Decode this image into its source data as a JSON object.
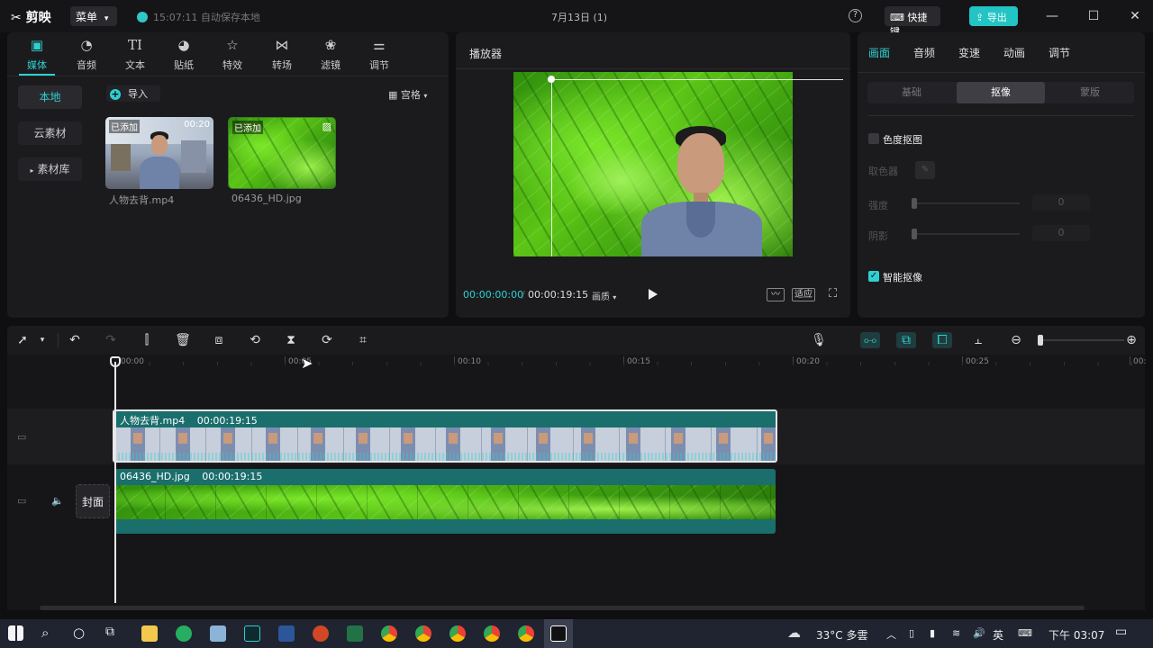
{
  "titlebar": {
    "app_name": "剪映",
    "menu_label": "菜单",
    "autosave": "15:07:11 自动保存本地",
    "project_title": "7月13日 (1)",
    "help": "?",
    "shortcut_label": "快捷键",
    "export_label": "导出",
    "minimize": "—",
    "maximize": "☐",
    "close": "✕"
  },
  "media": {
    "tabs": [
      {
        "label": "媒体",
        "icon": "media-icon"
      },
      {
        "label": "音频",
        "icon": "audio-icon"
      },
      {
        "label": "文本",
        "icon": "text-icon",
        "glyph": "TI"
      },
      {
        "label": "贴纸",
        "icon": "sticker-icon"
      },
      {
        "label": "特效",
        "icon": "effects-icon"
      },
      {
        "label": "转场",
        "icon": "transition-icon"
      },
      {
        "label": "滤镜",
        "icon": "filter-icon"
      },
      {
        "label": "调节",
        "icon": "adjust-icon"
      }
    ],
    "side": [
      "本地",
      "云素材",
      "素材库"
    ],
    "import_label": "导入",
    "view_label": "宫格",
    "items": [
      {
        "tag": "已添加",
        "duration": "00:20",
        "name": "人物去背.mp4"
      },
      {
        "tag": "已添加",
        "duration": "",
        "name": "06436_HD.jpg"
      }
    ]
  },
  "player": {
    "title": "播放器",
    "current_time": "00:00:00:00",
    "total_time": "00:00:19:15",
    "quality_label": "画质",
    "fit_label": "适应"
  },
  "props": {
    "tabs": [
      "画面",
      "音频",
      "变速",
      "动画",
      "调节"
    ],
    "segments": [
      "基础",
      "抠像",
      "蒙版"
    ],
    "chroma_key_label": "色度抠图",
    "color_picker_label": "取色器",
    "strength_label": "强度",
    "strength_value": "0",
    "shadow_label": "阴影",
    "shadow_value": "0",
    "smart_cutout_label": "智能抠像",
    "smart_cutout_checked": true
  },
  "timeline": {
    "ruler": [
      "00:00",
      "00:05",
      "00:10",
      "00:15",
      "00:20",
      "00:25",
      "00:"
    ],
    "clips": [
      {
        "name": "人物去背.mp4",
        "duration": "00:00:19:15"
      },
      {
        "name": "06436_HD.jpg",
        "duration": "00:00:19:15"
      }
    ],
    "cover_label": "封面"
  },
  "taskbar": {
    "weather": "33°C 多雲",
    "ime": "英",
    "clock": "下午 03:07"
  },
  "colors": {
    "accent": "#2fd0d0",
    "clip_teal": "#1a6e6c",
    "export_button": "#22c4c4"
  }
}
